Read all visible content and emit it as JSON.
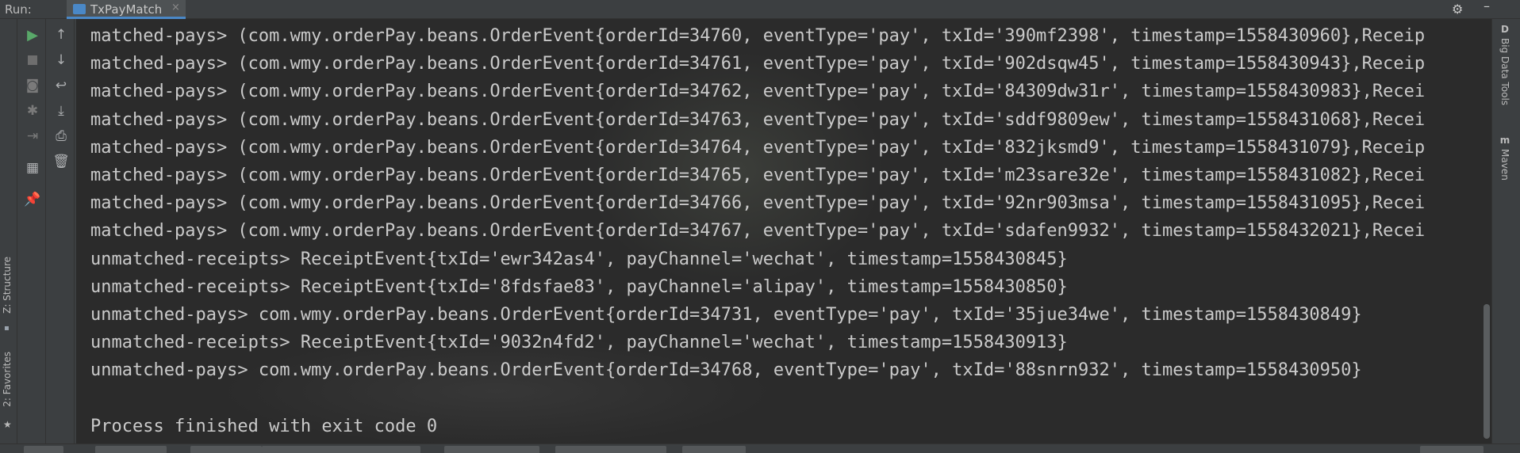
{
  "run_panel": {
    "label": "Run:",
    "tab_title": "TxPayMatch",
    "close_glyph": "×"
  },
  "top_right_icons": [
    "gear-icon",
    "minimize-icon"
  ],
  "left_strip": {
    "items": [
      "Z: Structure",
      "2: Favorites"
    ]
  },
  "toolbar_left": {
    "buttons": [
      "run-icon",
      "stop-icon",
      "camera-icon",
      "bug-icon",
      "exit-icon",
      "layout-icon",
      "pin-icon"
    ]
  },
  "toolbar_right": {
    "buttons": [
      "scroll-up-icon",
      "scroll-down-icon",
      "soft-wrap-icon",
      "scroll-to-end-icon",
      "print-icon",
      "trash-icon"
    ]
  },
  "right_strip": {
    "items": [
      "Big Data Tools",
      "Maven"
    ]
  },
  "console": {
    "lines": [
      "matched-pays> (com.wmy.orderPay.beans.OrderEvent{orderId=34760, eventType='pay', txId='390mf2398', timestamp=1558430960},Receip",
      "matched-pays> (com.wmy.orderPay.beans.OrderEvent{orderId=34761, eventType='pay', txId='902dsqw45', timestamp=1558430943},Receip",
      "matched-pays> (com.wmy.orderPay.beans.OrderEvent{orderId=34762, eventType='pay', txId='84309dw31r', timestamp=1558430983},Recei",
      "matched-pays> (com.wmy.orderPay.beans.OrderEvent{orderId=34763, eventType='pay', txId='sddf9809ew', timestamp=1558431068},Recei",
      "matched-pays> (com.wmy.orderPay.beans.OrderEvent{orderId=34764, eventType='pay', txId='832jksmd9', timestamp=1558431079},Receip",
      "matched-pays> (com.wmy.orderPay.beans.OrderEvent{orderId=34765, eventType='pay', txId='m23sare32e', timestamp=1558431082},Recei",
      "matched-pays> (com.wmy.orderPay.beans.OrderEvent{orderId=34766, eventType='pay', txId='92nr903msa', timestamp=1558431095},Recei",
      "matched-pays> (com.wmy.orderPay.beans.OrderEvent{orderId=34767, eventType='pay', txId='sdafen9932', timestamp=1558432021},Recei",
      "unmatched-receipts> ReceiptEvent{txId='ewr342as4', payChannel='wechat', timestamp=1558430845}",
      "unmatched-receipts> ReceiptEvent{txId='8fdsfae83', payChannel='alipay', timestamp=1558430850}",
      "unmatched-pays> com.wmy.orderPay.beans.OrderEvent{orderId=34731, eventType='pay', txId='35jue34we', timestamp=1558430849}",
      "unmatched-receipts> ReceiptEvent{txId='9032n4fd2', payChannel='wechat', timestamp=1558430913}",
      "unmatched-pays> com.wmy.orderPay.beans.OrderEvent{orderId=34768, eventType='pay', txId='88snrn932', timestamp=1558430950}",
      "",
      "Process finished with exit code 0"
    ]
  },
  "colors": {
    "console_bg": "#2b2b2b",
    "console_text": "#cacaca",
    "panel_bg": "#3c3f41",
    "accent": "#4a88c7",
    "run_green": "#59a869"
  }
}
